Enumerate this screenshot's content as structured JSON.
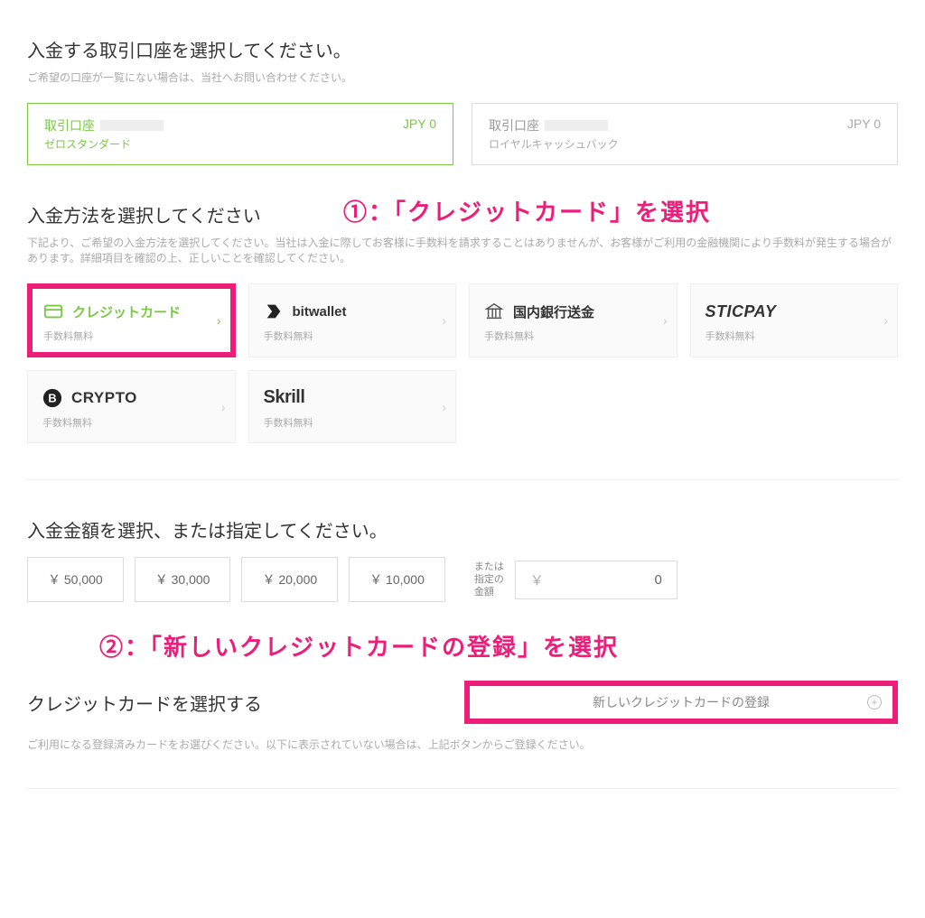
{
  "colors": {
    "accent_green": "#7ac943",
    "accent_pink": "#ec1e79"
  },
  "account_section": {
    "title": "入金する取引口座を選択してください。",
    "sub": "ご希望の口座が一覧にない場合は、当社へお問い合わせください。",
    "accounts": [
      {
        "name": "取引口座",
        "type": "ゼロスタンダード",
        "balance": "JPY 0",
        "selected": true
      },
      {
        "name": "取引口座",
        "type": "ロイヤルキャッシュバック",
        "balance": "JPY 0",
        "selected": false
      }
    ]
  },
  "method_section": {
    "title": "入金方法を選択してください",
    "sub": "下記より、ご希望の入金方法を選択してください。当社は入金に際してお客様に手数料を請求することはありませんが、お客様がご利用の金融機関により手数料が発生する場合があります。詳細項目を確認の上、正しいことを確認してください。",
    "fee_free": "手数料無料",
    "methods": [
      {
        "label": "クレジットカード",
        "icon": "card-icon",
        "selected": true
      },
      {
        "label": "bitwallet",
        "icon": "bitwallet-icon",
        "selected": false
      },
      {
        "label": "国内銀行送金",
        "icon": "bank-icon",
        "selected": false
      },
      {
        "label": "STICPAY",
        "icon": "sticpay-icon",
        "selected": false
      },
      {
        "label": "CRYPTO",
        "icon": "crypto-icon",
        "selected": false
      },
      {
        "label": "Skrill",
        "icon": "skrill-icon",
        "selected": false
      }
    ]
  },
  "amount_section": {
    "title": "入金金額を選択、または指定してください。",
    "presets": [
      "￥ 50,000",
      "￥ 30,000",
      "￥ 20,000",
      "￥ 10,000"
    ],
    "or_label": "または\n指定の\n金額",
    "currency": "￥",
    "input_value": "0"
  },
  "card_select_section": {
    "title": "クレジットカードを選択する",
    "sub": "ご利用になる登録済みカードをお選びください。以下に表示されていない場合は、上記ボタンからご登録ください。",
    "new_card_label": "新しいクレジットカードの登録"
  },
  "annotations": {
    "a1": "①：「クレジットカード」を選択",
    "a2": "②：「新しいクレジットカードの登録」を選択"
  }
}
